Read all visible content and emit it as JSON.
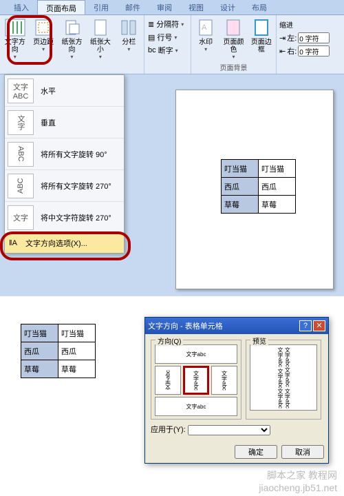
{
  "tabs": {
    "insert": "插入",
    "pagelayout": "页面布局",
    "ref": "引用",
    "mail": "邮件",
    "review": "审阅",
    "view": "视图",
    "design": "设计",
    "layout": "布局"
  },
  "ribbon": {
    "textdir": "文字方向",
    "margin": "页边距",
    "pagedir": "纸张方向",
    "size": "纸张大小",
    "cols": "分栏",
    "breaks": "分隔符",
    "linenum": "行号",
    "hyphen": "断字",
    "watermark": "水印",
    "pagecolor": "页面颜色",
    "pageborder": "页面边框",
    "indent": "缩进",
    "left": "左:",
    "right": "右:",
    "zero": "0 字符",
    "grp_bg": "页面背景"
  },
  "dropdown": {
    "thumb_text": "文字",
    "thumb_abc": "ABC",
    "horiz": "水平",
    "vert": "垂直",
    "rot90": "将所有文字旋转 90°",
    "rot270": "将所有文字旋转 270°",
    "cjk270": "将中文字符旋转 270°",
    "options": "文字方向选项(X)..."
  },
  "table": {
    "r1c1": "叮当猫",
    "r1c2": "叮当猫",
    "r2c1": "西瓜",
    "r2c2": "西瓜",
    "r3c1": "草莓",
    "r3c2": "草莓"
  },
  "dialog": {
    "title": "文字方向 - 表格单元格",
    "dir_label": "方向(Q)",
    "preview_label": "预览",
    "sample": "文字abc",
    "sample_v": "文字abc",
    "sample_long": "文字abc文字abc\n文字abc文字abc\n文字abc文字abc",
    "apply": "应用于(Y):",
    "ok": "确定",
    "cancel": "取消"
  },
  "watermark": "脚本之家 教程网\njiaocheng.jb51.net"
}
